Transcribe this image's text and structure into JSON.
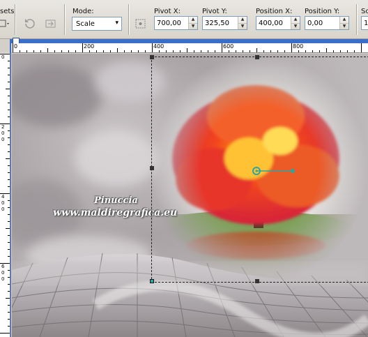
{
  "toolbar": {
    "presets_label": "sets:",
    "mode_label": "Mode:",
    "mode_value": "Scale",
    "pivot_x_label": "Pivot X:",
    "pivot_x_value": "700,00",
    "pivot_y_label": "Pivot Y:",
    "pivot_y_value": "325,50",
    "position_x_label": "Position X:",
    "position_x_value": "400,00",
    "position_y_label": "Position Y:",
    "position_y_value": "0,00",
    "extra_label": "Sc",
    "extra_value": "1"
  },
  "ruler": {
    "top_ticks": [
      "0",
      "200",
      "400",
      "600",
      "800"
    ],
    "left_ticks": [
      "0",
      "2",
      "0",
      "0",
      "4",
      "0",
      "0",
      "6",
      "0",
      "0"
    ]
  },
  "watermark": {
    "line1": "Pinuccia",
    "line2": "www.maldiregrafica.eu"
  },
  "colors": {
    "selection_pivot": "#2aa6a0",
    "canvas_fog": "#b8b3b5",
    "accent_title": "#3a6ec8"
  }
}
